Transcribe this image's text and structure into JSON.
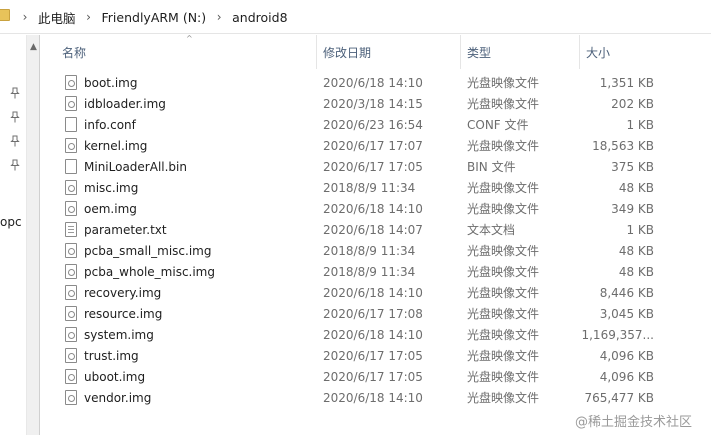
{
  "breadcrumb": [
    "此电脑",
    "FriendlyARM (N:)",
    "android8"
  ],
  "nav_partial_label": "opc",
  "columns": {
    "name": "名称",
    "date": "修改日期",
    "type": "类型",
    "size": "大小"
  },
  "files": [
    {
      "name": "boot.img",
      "date": "2020/6/18 14:10",
      "type": "光盘映像文件",
      "size": "1,351 KB",
      "icon": "disc-image-file-icon"
    },
    {
      "name": "idbloader.img",
      "date": "2020/3/18 14:15",
      "type": "光盘映像文件",
      "size": "202 KB",
      "icon": "disc-image-file-icon"
    },
    {
      "name": "info.conf",
      "date": "2020/6/23 16:54",
      "type": "CONF 文件",
      "size": "1 KB",
      "icon": "blank-file-icon"
    },
    {
      "name": "kernel.img",
      "date": "2020/6/17 17:07",
      "type": "光盘映像文件",
      "size": "18,563 KB",
      "icon": "disc-image-file-icon"
    },
    {
      "name": "MiniLoaderAll.bin",
      "date": "2020/6/17 17:05",
      "type": "BIN 文件",
      "size": "375 KB",
      "icon": "blank-file-icon"
    },
    {
      "name": "misc.img",
      "date": "2018/8/9 11:34",
      "type": "光盘映像文件",
      "size": "48 KB",
      "icon": "disc-image-file-icon"
    },
    {
      "name": "oem.img",
      "date": "2020/6/18 14:10",
      "type": "光盘映像文件",
      "size": "349 KB",
      "icon": "disc-image-file-icon"
    },
    {
      "name": "parameter.txt",
      "date": "2020/6/18 14:07",
      "type": "文本文档",
      "size": "1 KB",
      "icon": "text-file-icon"
    },
    {
      "name": "pcba_small_misc.img",
      "date": "2018/8/9 11:34",
      "type": "光盘映像文件",
      "size": "48 KB",
      "icon": "disc-image-file-icon"
    },
    {
      "name": "pcba_whole_misc.img",
      "date": "2018/8/9 11:34",
      "type": "光盘映像文件",
      "size": "48 KB",
      "icon": "disc-image-file-icon"
    },
    {
      "name": "recovery.img",
      "date": "2020/6/18 14:10",
      "type": "光盘映像文件",
      "size": "8,446 KB",
      "icon": "disc-image-file-icon"
    },
    {
      "name": "resource.img",
      "date": "2020/6/17 17:08",
      "type": "光盘映像文件",
      "size": "3,045 KB",
      "icon": "disc-image-file-icon"
    },
    {
      "name": "system.img",
      "date": "2020/6/18 14:10",
      "type": "光盘映像文件",
      "size": "1,169,357...",
      "icon": "disc-image-file-icon"
    },
    {
      "name": "trust.img",
      "date": "2020/6/17 17:05",
      "type": "光盘映像文件",
      "size": "4,096 KB",
      "icon": "disc-image-file-icon"
    },
    {
      "name": "uboot.img",
      "date": "2020/6/17 17:05",
      "type": "光盘映像文件",
      "size": "4,096 KB",
      "icon": "disc-image-file-icon"
    },
    {
      "name": "vendor.img",
      "date": "2020/6/18 14:10",
      "type": "光盘映像文件",
      "size": "765,477 KB",
      "icon": "disc-image-file-icon"
    }
  ],
  "watermark": "@稀土掘金技术社区"
}
